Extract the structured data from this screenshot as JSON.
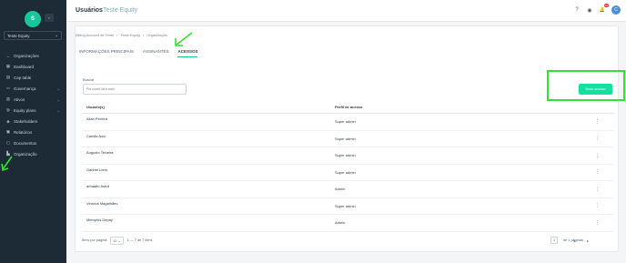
{
  "sidebar": {
    "avatar_letter": "S",
    "collapse": "«",
    "company": "Teste Equity",
    "company_chevron": "⌄",
    "items": [
      {
        "label": "Organizações",
        "icon": "arrow-left-icon",
        "glyph": "←",
        "chevron": ""
      },
      {
        "label": "Dashboard",
        "icon": "dashboard-icon",
        "glyph": "▦",
        "chevron": ""
      },
      {
        "label": "Cap table",
        "icon": "table-icon",
        "glyph": "▤",
        "chevron": ""
      },
      {
        "label": "Governança",
        "icon": "governance-icon",
        "glyph": "▭",
        "chevron": "⌄"
      },
      {
        "label": "Ativos",
        "icon": "assets-icon",
        "glyph": "▥",
        "chevron": "⌄"
      },
      {
        "label": "Equity plans",
        "icon": "equity-icon",
        "glyph": "◍",
        "chevron": "⌄"
      },
      {
        "label": "Stakeholders",
        "icon": "people-icon",
        "glyph": "☻",
        "chevron": ""
      },
      {
        "label": "Relatórios",
        "icon": "report-icon",
        "glyph": "▣",
        "chevron": ""
      },
      {
        "label": "Documentos",
        "icon": "folder-icon",
        "glyph": "▢",
        "chevron": ""
      },
      {
        "label": "Organização",
        "icon": "building-icon",
        "glyph": "▙",
        "chevron": ""
      }
    ]
  },
  "topbar": {
    "title": "Usuários",
    "subtitle": "Teste Equity",
    "help_glyph": "?",
    "eye_glyph": "◉",
    "bell_glyph": "🔔",
    "notif_count": "13",
    "user_initial": "C"
  },
  "breadcrumb": {
    "parts": [
      "Billing Account de Teste",
      "/",
      "Teste Equity",
      "/",
      "Organização"
    ]
  },
  "tabs": [
    {
      "label": "INFORMAÇÕES PRINCIPAIS",
      "active": false
    },
    {
      "label": "ASSINANTES",
      "active": false
    },
    {
      "label": "ACESSOS",
      "active": true
    }
  ],
  "search": {
    "label": "Buscar",
    "placeholder": "Por nome ou e-mail"
  },
  "new_access_button": "Novo acesso",
  "table": {
    "headers": [
      "Usuário(s)",
      "Perfil de acesso"
    ],
    "rows": [
      {
        "user": "Allan Pereira",
        "profile": "Super admin"
      },
      {
        "user": "Camila Aulo",
        "profile": "Super admin"
      },
      {
        "user": "Augusto Teixeira",
        "profile": "Super admin"
      },
      {
        "user": "Gabriel Lima",
        "profile": "Super admin"
      },
      {
        "user": "arbaaffo Asfull",
        "profile": "Admin"
      },
      {
        "user": "Vinicius Magalhães",
        "profile": "Super admin"
      },
      {
        "user": "Memphis Depay",
        "profile": "Admin"
      }
    ],
    "row_menu_glyph": "⋮"
  },
  "pager": {
    "per_page_label": "Itens por página:",
    "per_page": "10 ⌄",
    "range": "1 — 7 de 7 itens",
    "page": "1",
    "page_of": "de 1 páginas",
    "nav": "◂ ▸"
  },
  "colors": {
    "accent": "#16c79a",
    "button": "#16e0a0",
    "highlight": "#33e033",
    "sidebar": "#1d2b36"
  }
}
